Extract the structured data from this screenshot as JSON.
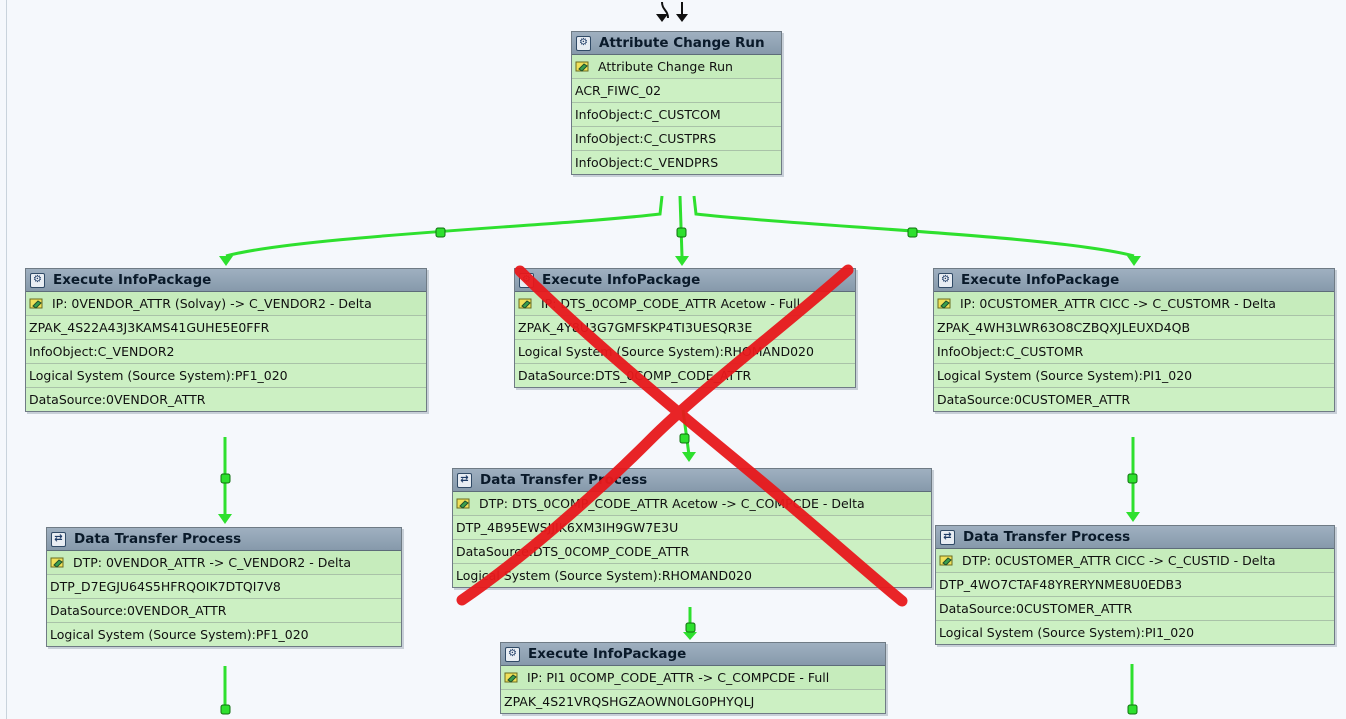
{
  "colors": {
    "connector": "#2ee02e",
    "node_body": "#ccf0c3",
    "header": "#8fa1b3",
    "cross": "#e8191c"
  },
  "nodes": [
    {
      "id": "acr",
      "title": "Attribute Change Run",
      "title_icon": "gear-cluster-icon",
      "rows": [
        "Attribute Change Run",
        "ACR_FIWC_02",
        "InfoObject:C_CUSTCOM",
        "InfoObject:C_CUSTPRS",
        "InfoObject:C_VENDPRS"
      ]
    },
    {
      "id": "ip-vendor",
      "title": "Execute InfoPackage",
      "title_icon": "gear-icon",
      "rows": [
        "IP: 0VENDOR_ATTR (Solvay) -> C_VENDOR2 - Delta",
        "ZPAK_4S22A43J3KAMS41GUHE5E0FFR",
        "InfoObject:C_VENDOR2",
        "Logical System (Source System):PF1_020",
        "DataSource:0VENDOR_ATTR"
      ]
    },
    {
      "id": "ip-compcode",
      "title": "Execute InfoPackage",
      "title_icon": "gear-icon",
      "rows": [
        "IP: DTS_0COMP_CODE_ATTR Acetow - Full",
        "ZPAK_4Y8U3G7GMFSKP4TI3UESQR3E",
        "Logical System (Source System):RHOMAND020",
        "DataSource:DTS_0COMP_CODE_ATTR"
      ]
    },
    {
      "id": "ip-customer",
      "title": "Execute InfoPackage",
      "title_icon": "gear-icon",
      "rows": [
        "IP: 0CUSTOMER_ATTR CICC -> C_CUSTOMR - Delta",
        "ZPAK_4WH3LWR63O8CZBQXJLEUXD4QB",
        "InfoObject:C_CUSTOMR",
        "Logical System (Source System):PI1_020",
        "DataSource:0CUSTOMER_ATTR"
      ]
    },
    {
      "id": "dtp-vendor",
      "title": "Data Transfer Process",
      "title_icon": "transfer-icon",
      "rows": [
        "DTP: 0VENDOR_ATTR -> C_VENDOR2 - Delta",
        "DTP_D7EGJU64S5HFRQOIK7DTQI7V8",
        "DataSource:0VENDOR_ATTR",
        "Logical System (Source System):PF1_020"
      ]
    },
    {
      "id": "dtp-compcode",
      "title": "Data Transfer Process",
      "title_icon": "transfer-icon",
      "rows": [
        "DTP: DTS_0COMP_CODE_ATTR Acetow -> C_COMPCDE - Delta",
        "DTP_4B95EWSJJIK6XM3IH9GW7E3U",
        "DataSource:DTS_0COMP_CODE_ATTR",
        "Logical System (Source System):RHOMAND020"
      ]
    },
    {
      "id": "dtp-customer",
      "title": "Data Transfer Process",
      "title_icon": "transfer-icon",
      "rows": [
        "DTP: 0CUSTOMER_ATTR CICC -> C_CUSTID - Delta",
        "DTP_4WO7CTAF48YRERYNME8U0EDB3",
        "DataSource:0CUSTOMER_ATTR",
        "Logical System (Source System):PI1_020"
      ]
    },
    {
      "id": "ip-pi1",
      "title": "Execute InfoPackage",
      "title_icon": "gear-icon",
      "rows": [
        "IP: PI1 0COMP_CODE_ATTR -> C_COMPCDE - Full",
        "ZPAK_4S21VRQSHGZAOWN0LG0PHYQLJ"
      ]
    }
  ]
}
